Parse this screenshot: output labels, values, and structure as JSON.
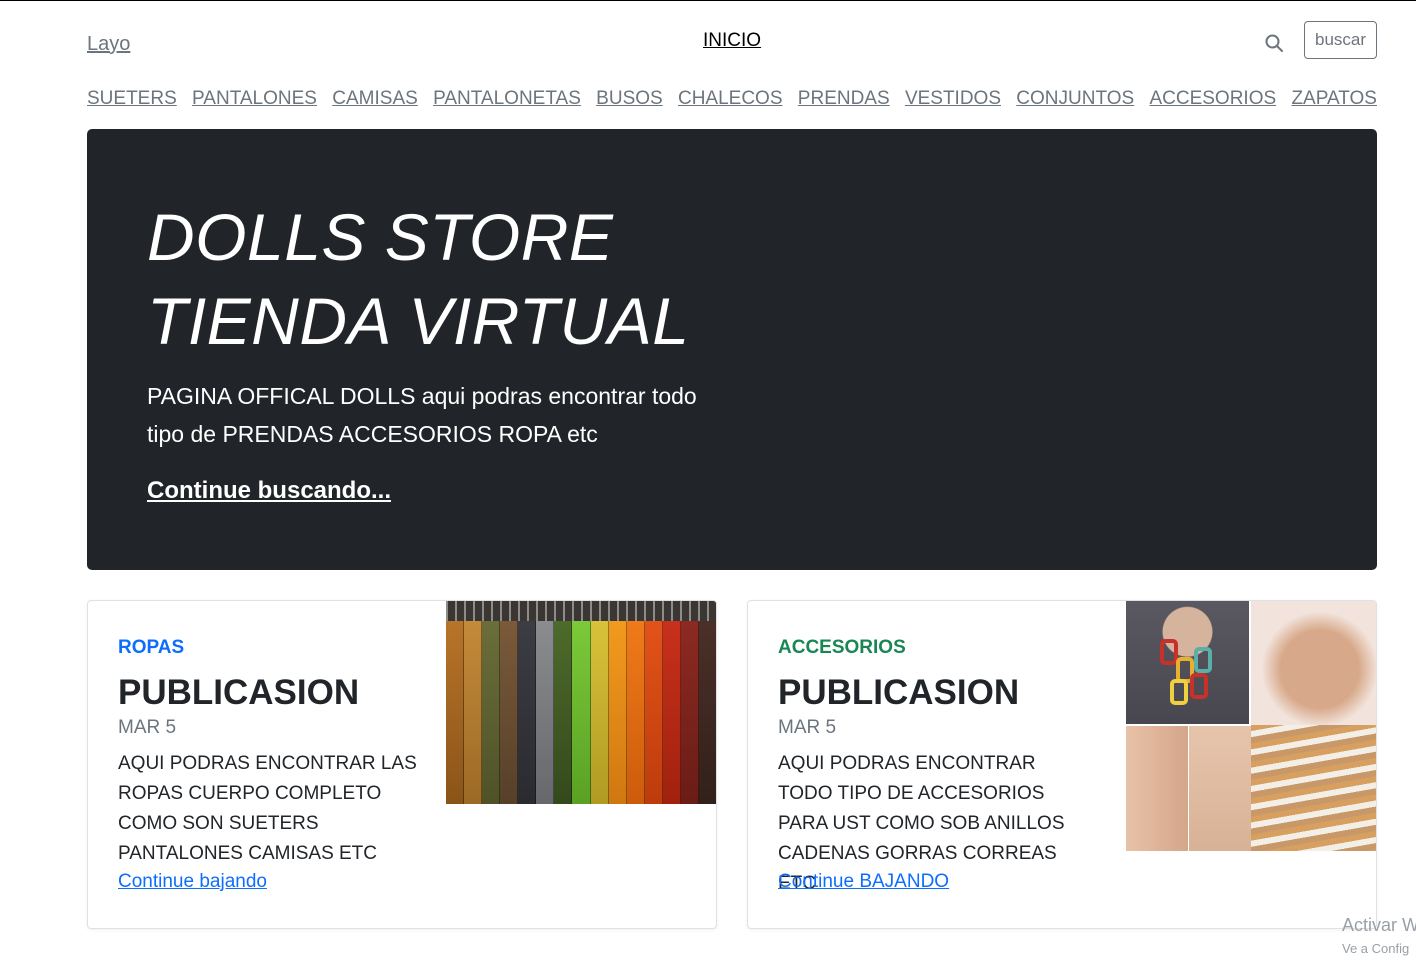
{
  "header": {
    "logo": "Layo",
    "home_link": "INICIO",
    "search_button": "buscar"
  },
  "categories": [
    "SUETERS",
    "PANTALONES",
    "CAMISAS",
    "PANTALONETAS",
    "BUSOS",
    "CHALECOS",
    "PRENDAS",
    "VESTIDOS",
    "CONJUNTOS",
    "ACCESORIOS",
    "ZAPATOS"
  ],
  "hero": {
    "title_line1": "DOLLS STORE",
    "title_line2": "TIENDA VIRTUAL",
    "text": "PAGINA OFFICAL DOLLS aqui podras encontrar todo tipo de PRENDAS ACCESORIOS ROPA etc",
    "link": "Continue buscando..."
  },
  "cards": [
    {
      "category": "ROPAS",
      "category_color": "#0d6efd",
      "title": "PUBLICASION",
      "date": "MAR 5",
      "text": "AQUI PODRAS ENCONTRAR LAS ROPAS CUERPO COMPLETO COMO SON SUETERS PANTALONES CAMISAS ETC",
      "link": "Continue bajando",
      "image": "clothes-rack-image"
    },
    {
      "category": "ACCESORIOS",
      "category_color": "#198754",
      "title": "PUBLICASION",
      "date": "MAR 5",
      "text": "AQUI PODRAS ENCONTRAR TODO TIPO DE ACCESORIOS PARA UST COMO SOB ANILLOS CADENAS GORRAS CORREAS ETC",
      "link": "Continue BAJANDO",
      "image": "jewelry-collage-image"
    }
  ],
  "watermark": {
    "line1": "Activar W",
    "line2": "Ve a Config"
  }
}
